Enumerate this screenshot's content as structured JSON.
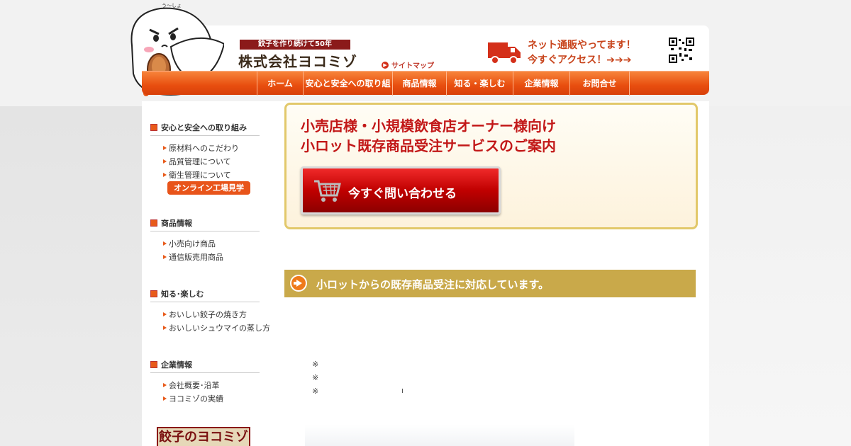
{
  "header": {
    "tagline": "餃子を作り続けて50年",
    "company_name": "株式会社ヨコミゾ",
    "sitemap_label": "サイトマップ",
    "online_line1": "ネット通販やってます！",
    "online_line2": "今すぐアクセス！➔➔➔"
  },
  "nav": {
    "items": [
      {
        "label": "ホーム"
      },
      {
        "label": "安心と安全への取り組み"
      },
      {
        "label": "商品情報"
      },
      {
        "label": "知る・楽しむ"
      },
      {
        "label": "企業情報"
      },
      {
        "label": "お問合せ"
      }
    ]
  },
  "sidebar": {
    "safety": {
      "title": "安心と安全への取り組み",
      "items": [
        "原材料へのこだわり",
        "品質管理について",
        "衛生管理について"
      ],
      "factory_tour": "オンライン工場見学"
    },
    "products": {
      "title": "商品情報",
      "items": [
        "小売向け商品",
        "通信販売用商品"
      ]
    },
    "learn": {
      "title": "知る･楽しむ",
      "items": [
        "おいしい餃子の焼き方",
        "おいしいシュウマイの蒸し方"
      ]
    },
    "company": {
      "title": "企業情報",
      "items": [
        "会社概要･沿革",
        "ヨコミゾの実績"
      ]
    },
    "logo_text": "餃子のヨコミゾ"
  },
  "banner": {
    "title_line1": "小売店様・小規模飲食店オーナー様向け",
    "title_line2": "小ロット既存商品受注サービスのご案内",
    "cta_label": "今すぐ問い合わせる"
  },
  "section": {
    "heading": "小ロットからの既存商品受注に対応しています。",
    "notes": [
      "※",
      "※",
      "※"
    ]
  },
  "colors": {
    "accent_orange": "#e84e0f",
    "banner_red": "#c21818",
    "gold": "#c9a94a"
  }
}
